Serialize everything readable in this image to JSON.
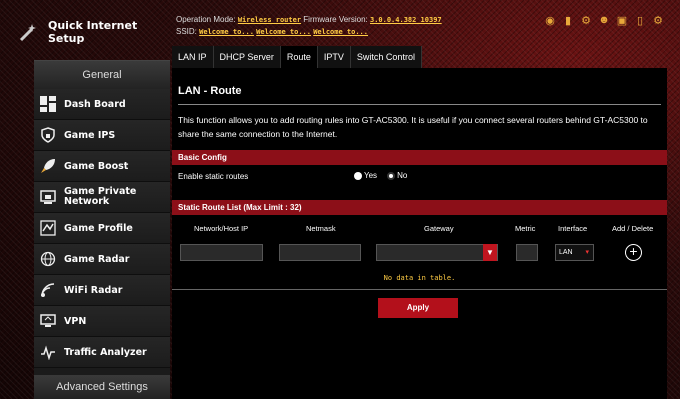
{
  "quick_setup": {
    "label": "Quick Internet Setup",
    "icon": "magic-wand-icon"
  },
  "sidebar": {
    "general_header": "General",
    "items": [
      {
        "label": "Dash Board",
        "icon": "dashboard-icon"
      },
      {
        "label": "Game IPS",
        "icon": "lock-shield-icon"
      },
      {
        "label": "Game Boost",
        "icon": "rocket-icon"
      },
      {
        "label": "Game Private Network",
        "icon": "private-network-icon"
      },
      {
        "label": "Game Profile",
        "icon": "game-profile-icon"
      },
      {
        "label": "Game Radar",
        "icon": "globe-radar-icon"
      },
      {
        "label": "WiFi Radar",
        "icon": "wifi-radar-icon"
      },
      {
        "label": "VPN",
        "icon": "vpn-icon"
      },
      {
        "label": "Traffic Analyzer",
        "icon": "traffic-analyzer-icon"
      }
    ],
    "advanced_header": "Advanced Settings"
  },
  "topinfo": {
    "op_mode_label": "Operation Mode:",
    "op_mode_value": "Wireless router",
    "fw_label": "Firmware Version:",
    "fw_value": "3.0.0.4.382_10397",
    "ssid_label": "SSID:",
    "ssid_values": [
      "Welcome to...",
      "Welcome to...",
      "Welcome to..."
    ]
  },
  "tabs": [
    "LAN IP",
    "DHCP Server",
    "Route",
    "IPTV",
    "Switch Control"
  ],
  "active_tab": "Route",
  "page": {
    "title": "LAN - Route",
    "description": "This function allows you to add routing rules into GT-AC5300. It is useful if you connect several routers behind GT-AC5300 to share the same connection to the Internet."
  },
  "basic_config": {
    "header": "Basic Config",
    "static_routes_label": "Enable static routes",
    "options": [
      "Yes",
      "No"
    ],
    "selected": "No"
  },
  "route_list": {
    "header": "Static Route List (Max Limit : 32)",
    "columns": [
      "Network/Host IP",
      "Netmask",
      "Gateway",
      "Metric",
      "Interface",
      "Add / Delete"
    ],
    "interface_value": "LAN",
    "empty_message": "No data in table."
  },
  "apply_label": "Apply",
  "colors": {
    "accent": "#b3101b",
    "section_bar": "#8c0f18",
    "link": "#ffcc44"
  }
}
